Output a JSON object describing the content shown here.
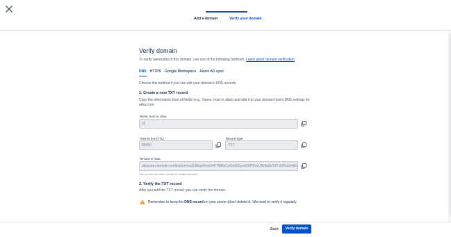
{
  "header": {
    "close_icon": "close-icon",
    "steps": [
      "Add a domain",
      "Verify your domain"
    ],
    "active_step": 2
  },
  "main": {
    "title": "Verify domain",
    "intro": "To verify ownership of this domain, use one of the following methods.",
    "intro_link": "Learn about domain verification",
    "tabs": [
      "DNS",
      "HTTPS",
      "Google Workspace",
      "Azure AD sync"
    ],
    "active_tab": "DNS",
    "help": "Choose this method if you can edit your domain’s DNS records.",
    "section1": {
      "heading": "1. Create a new TXT record",
      "text": "Copy the information from all fields (e.g., Name, host or alias) and add it to your domain host’s DNS settings for akku.com."
    },
    "fields": {
      "name": {
        "label": "Name, host or alias",
        "value": "@"
      },
      "ttl": {
        "label": "Time to live (TTL)",
        "value": "86400"
      },
      "type": {
        "label": "Record type",
        "value": "TXT"
      },
      "record": {
        "label": "Record or data",
        "value": "atlassian-domain-verification=xs3tJtKqoRejrD4F7M8wCo2nN0SywDiXPZovL0Elta3oTZFcNPoZq4j0n"
      }
    },
    "hint": "You can use the same record for multiple domains.",
    "section2": {
      "heading": "2. Verify the TXT record",
      "text": "After you add the TXT record, you can verify the domain."
    },
    "warning": {
      "icon": "warning-icon",
      "pre": "Remember to keep the ",
      "bold": "DNS record",
      "post": " on your server (don’t delete it). We need to verify it regularly."
    }
  },
  "footer": {
    "back_label": "Back",
    "verify_label": "Verify domain"
  },
  "colors": {
    "accent": "#0052cc",
    "warning": "#ff8b00",
    "text": "#172b4d"
  }
}
